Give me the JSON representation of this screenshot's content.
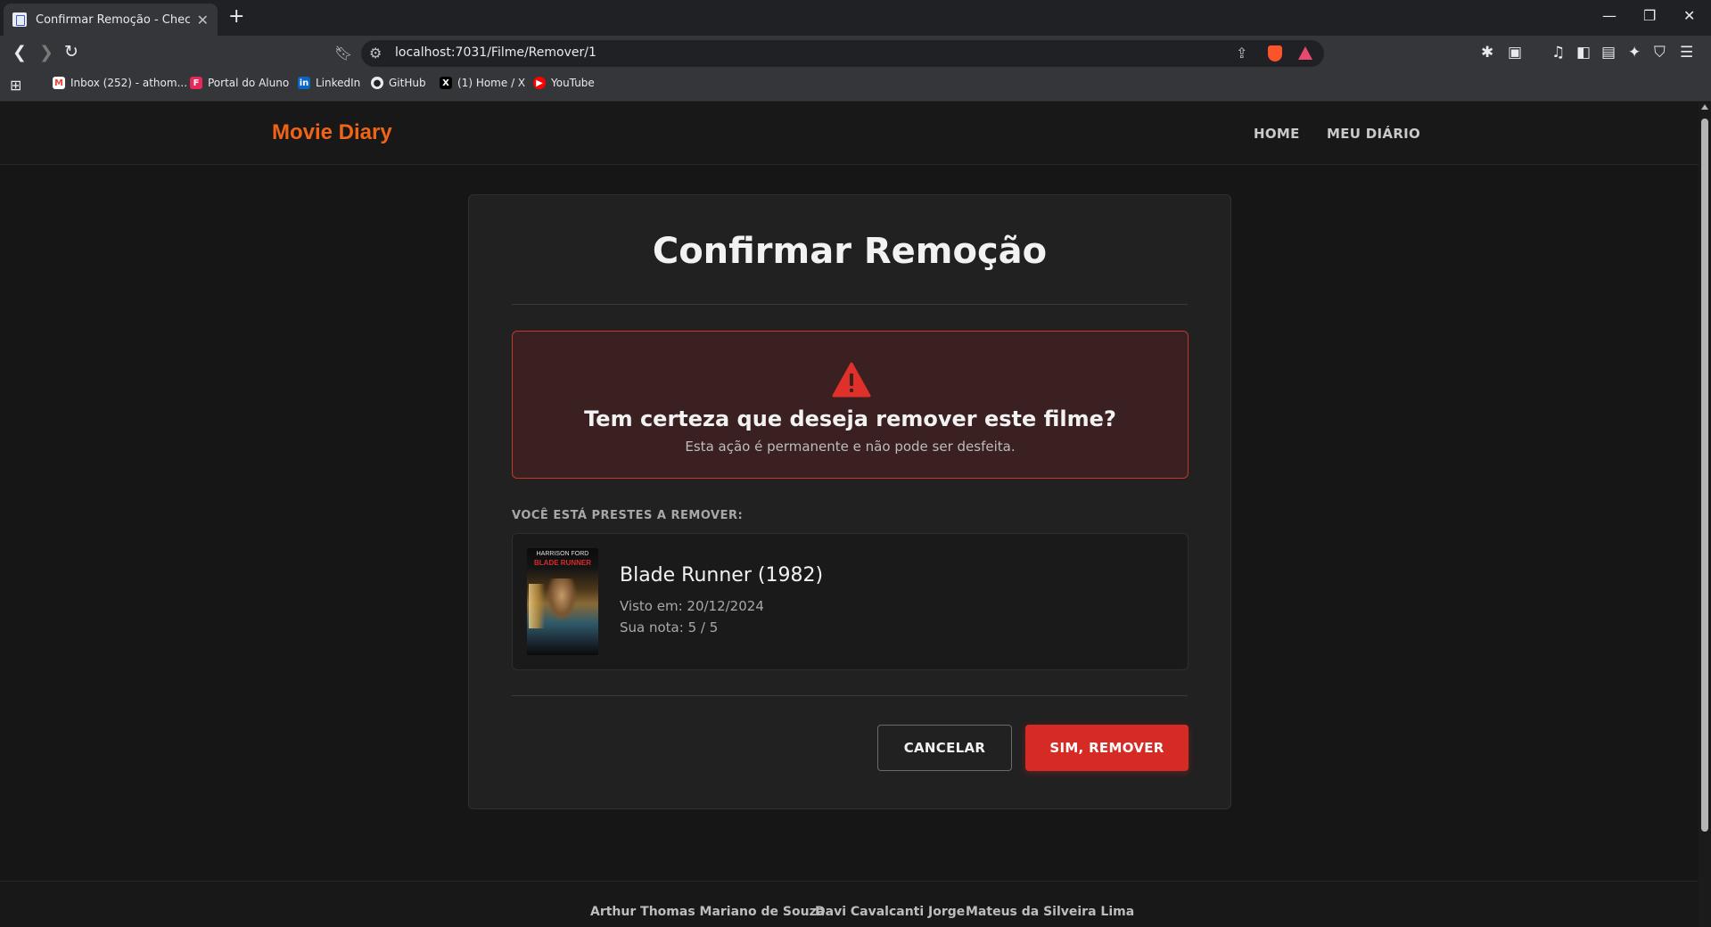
{
  "browser": {
    "tab_title": "Confirmar Remoção - Checkpoin",
    "url": "localhost:7031/Filme/Remover/1",
    "bookmarks": [
      {
        "label": "Inbox (252) - athom...",
        "icon": "gmail-icon",
        "color": "#ea4335"
      },
      {
        "label": "Portal do Aluno",
        "icon": "portal-icon",
        "color": "#e8285a"
      },
      {
        "label": "LinkedIn",
        "icon": "linkedin-icon",
        "color": "#0a66c2"
      },
      {
        "label": "GitHub",
        "icon": "github-icon",
        "color": "#e8eaed"
      },
      {
        "label": "(1) Home / X",
        "icon": "x-icon",
        "color": "#000000"
      },
      {
        "label": "YouTube",
        "icon": "youtube-icon",
        "color": "#ff0000"
      }
    ]
  },
  "site": {
    "brand": "Movie Diary",
    "brand_color": "#f06418",
    "nav": [
      {
        "label": "HOME"
      },
      {
        "label": "MEU DIÁRIO"
      }
    ]
  },
  "confirm": {
    "title": "Confirmar Remoção",
    "warning_title": "Tem certeza que deseja remover este filme?",
    "warning_text": "Esta ação é permanente e não pode ser desfeita.",
    "section_label": "VOCÊ ESTÁ PRESTES A REMOVER:",
    "movie": {
      "title": "Blade Runner (1982)",
      "watched": "Visto em: 20/12/2024",
      "rating": "Sua nota: 5 / 5",
      "poster_top": "HARRISON FORD",
      "poster_name": "BLADE RUNNER"
    },
    "cancel_label": "CANCELAR",
    "remove_label": "SIM, REMOVER",
    "danger_color": "#d62b24"
  },
  "footer": {
    "names": [
      "Arthur Thomas Mariano de Souza",
      "Davi Cavalcanti Jorge",
      "Mateus da Silveira Lima"
    ]
  }
}
